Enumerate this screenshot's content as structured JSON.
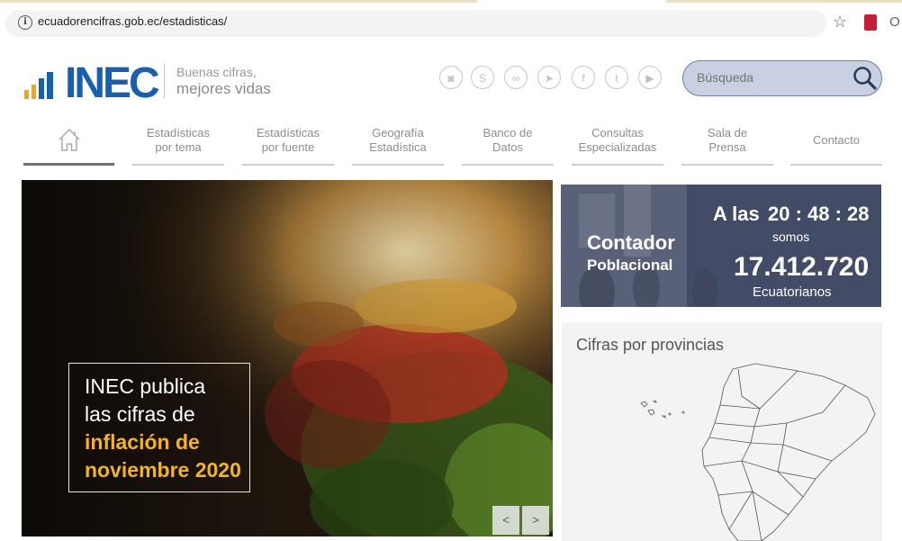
{
  "browser": {
    "url": "ecuadorencifras.gob.ec/estadisticas/",
    "info_icon": "info-icon",
    "star_icon": "star-icon"
  },
  "header": {
    "logo_text": "INEC",
    "tagline_line1": "Buenas cifras,",
    "tagline_line2": "mejores vidas",
    "social_icons": [
      "instagram-icon",
      "skype-icon",
      "flickr-icon",
      "telegram-icon",
      "facebook-icon",
      "twitter-icon",
      "youtube-icon"
    ],
    "search": {
      "placeholder": "Búsqueda",
      "icon": "search-icon"
    }
  },
  "nav": {
    "home_icon": "home-icon",
    "items": [
      {
        "line1": "Estadísticas",
        "line2": "por tema"
      },
      {
        "line1": "Estadísticas",
        "line2": "por fuente"
      },
      {
        "line1": "Geografía",
        "line2": "Estadística"
      },
      {
        "line1": "Banco de",
        "line2": "Datos"
      },
      {
        "line1": "Consultas",
        "line2": "Especializadas"
      },
      {
        "line1": "Sala de",
        "line2": "Prensa"
      },
      {
        "line1": "Contacto",
        "line2": ""
      }
    ]
  },
  "hero": {
    "line1": "INEC publica",
    "line2": "las cifras de",
    "line3": "inflación de",
    "line4": "noviembre 2020",
    "prev_label": "<",
    "next_label": ">"
  },
  "counter": {
    "title": "Contador",
    "subtitle": "Poblacional",
    "time_prefix": "A las",
    "time": "20 : 48 : 28",
    "somos": "somos",
    "population": "17.412.720",
    "unit": "Ecuatorianos"
  },
  "provinces": {
    "title": "Cifras por provincias"
  },
  "colors": {
    "brand_blue": "#1a5fac",
    "logo_orange": "#f2a51a",
    "highlight_gold": "#f2b424",
    "counter_bg": "#434c66"
  }
}
